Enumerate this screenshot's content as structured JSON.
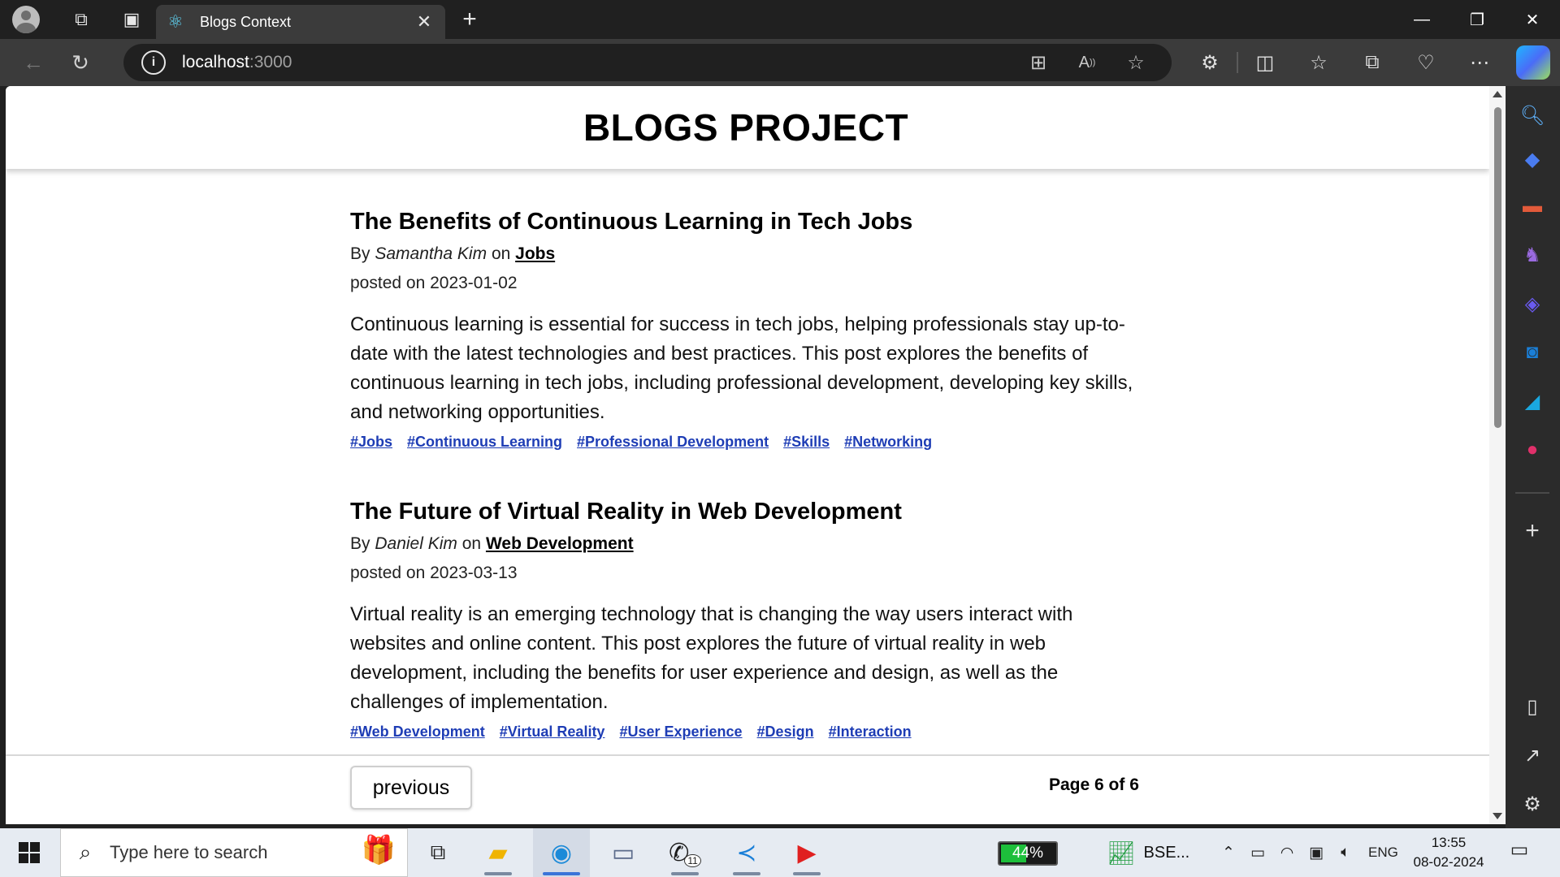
{
  "browser": {
    "tab_title": "Blogs Context",
    "url_host": "localhost",
    "url_port": ":3000"
  },
  "page": {
    "title": "BLOGS PROJECT",
    "posts": [
      {
        "title": "The Benefits of Continuous Learning in Tech Jobs",
        "by_label": "By",
        "author": "Samantha Kim",
        "on_label": "on",
        "category": "Jobs",
        "date_label": "posted on",
        "date": "2023-01-02",
        "content": "Continuous learning is essential for success in tech jobs, helping professionals stay up-to-date with the latest technologies and best practices. This post explores the benefits of continuous learning in tech jobs, including professional development, developing key skills, and networking opportunities.",
        "tags": [
          "#Jobs",
          "#Continuous Learning",
          "#Professional Development",
          "#Skills",
          "#Networking"
        ]
      },
      {
        "title": "The Future of Virtual Reality in Web Development",
        "by_label": "By",
        "author": "Daniel Kim",
        "on_label": "on",
        "category": "Web Development",
        "date_label": "posted on",
        "date": "2023-03-13",
        "content": "Virtual reality is an emerging technology that is changing the way users interact with websites and online content. This post explores the future of virtual reality in web development, including the benefits for user experience and design, as well as the challenges of implementation.",
        "tags": [
          "#Web Development",
          "#Virtual Reality",
          "#User Experience",
          "#Design",
          "#Interaction"
        ]
      }
    ],
    "pagination": {
      "previous_label": "previous",
      "page_text": "Page 6 of 6"
    }
  },
  "taskbar": {
    "search_placeholder": "Type here to search",
    "battery_percent": "44%",
    "stock_label": "BSE...",
    "language": "ENG",
    "time": "13:55",
    "date": "08-02-2024",
    "whatsapp_badge": "11"
  },
  "colors": {
    "tag_link": "#1e3db5",
    "battery_fill": "#1dbf3b"
  }
}
